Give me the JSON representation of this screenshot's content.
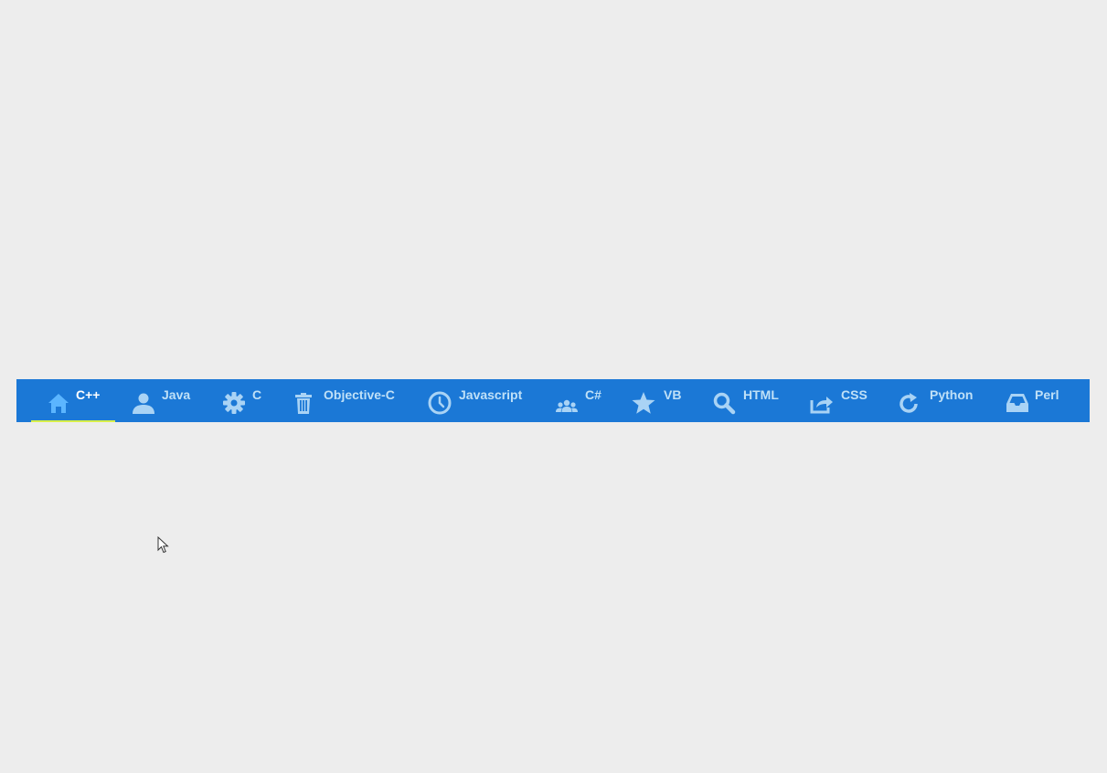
{
  "colors": {
    "background": "#ededed",
    "navbar": "#1b78d6",
    "icon": "#a9d3f5",
    "icon_active": "#5bb5ff",
    "label": "#bfe0f7",
    "label_active": "#ffffff",
    "active_indicator": "#d9f04a"
  },
  "nav": {
    "active_index": 0,
    "items": [
      {
        "label": "C++",
        "icon": "home-icon"
      },
      {
        "label": "Java",
        "icon": "user-icon"
      },
      {
        "label": "C",
        "icon": "gear-icon"
      },
      {
        "label": "Objective-C",
        "icon": "trash-icon"
      },
      {
        "label": "Javascript",
        "icon": "clock-icon"
      },
      {
        "label": "C#",
        "icon": "group-icon"
      },
      {
        "label": "VB",
        "icon": "star-icon"
      },
      {
        "label": "HTML",
        "icon": "search-icon"
      },
      {
        "label": "CSS",
        "icon": "share-icon"
      },
      {
        "label": "Python",
        "icon": "refresh-icon"
      },
      {
        "label": "Perl",
        "icon": "inbox-icon"
      }
    ]
  }
}
